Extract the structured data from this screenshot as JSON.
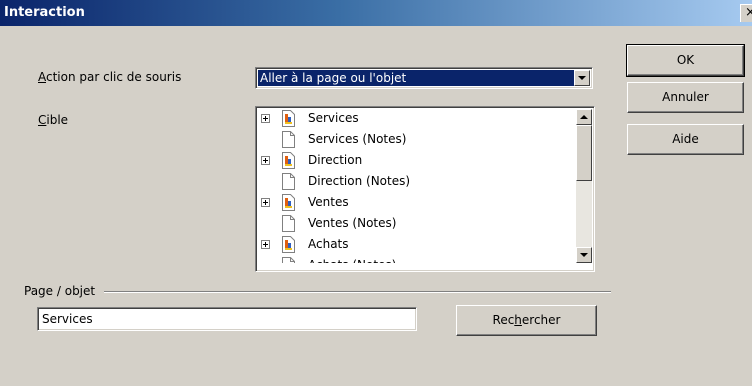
{
  "window": {
    "title": "Interaction",
    "close_glyph": "×"
  },
  "action": {
    "label_accel": "A",
    "label_rest": "ction par clic de souris",
    "selected": "Aller à la page ou l'objet"
  },
  "target": {
    "label_accel": "C",
    "label_rest": "ible",
    "items": [
      {
        "label": "Services",
        "expandable": true
      },
      {
        "label": "Services (Notes)",
        "expandable": false
      },
      {
        "label": "Direction",
        "expandable": true
      },
      {
        "label": "Direction (Notes)",
        "expandable": false
      },
      {
        "label": "Ventes",
        "expandable": true
      },
      {
        "label": "Ventes (Notes)",
        "expandable": false
      },
      {
        "label": "Achats",
        "expandable": true
      },
      {
        "label": "Achats (Notes)",
        "expandable": false
      }
    ]
  },
  "page_object": {
    "label": "Page / objet",
    "value": "Services"
  },
  "search_button": {
    "pre": "Rec",
    "accel": "h",
    "post": "ercher"
  },
  "buttons": {
    "ok": "OK",
    "cancel": "Annuler",
    "help": "Aide"
  }
}
